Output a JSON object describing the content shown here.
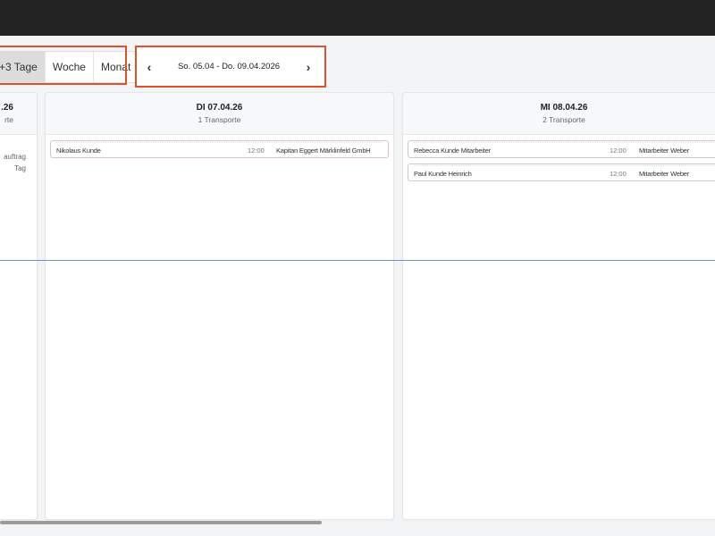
{
  "view_switch": {
    "options": [
      "+3 Tage",
      "Woche",
      "Monat"
    ],
    "active": "+3 Tage"
  },
  "date_nav": {
    "prev_icon": "chevron-left-icon",
    "next_icon": "chevron-right-icon",
    "range": "So. 05.04 - Do. 09.04.2026"
  },
  "days": [
    {
      "title": ".26",
      "subtitle": "rte",
      "note_line1": "auftrag",
      "note_line2": "Tag"
    },
    {
      "title": "DI 07.04.26",
      "subtitle": "1 Transporte",
      "transports": [
        {
          "left": "Nikolaus Kunde",
          "mid": "12:00",
          "right": "Kapitan Eggert Märklinfeld GmbH"
        }
      ]
    },
    {
      "title": "MI 08.04.26",
      "subtitle": "2 Transporte",
      "transports": [
        {
          "left": "Rebecca Kunde Mitarbeiter",
          "mid": "12:00",
          "right": "Mitarbeiter Weber"
        },
        {
          "left": "Paul Kunde Heinrich",
          "mid": "12:00",
          "right": "Mitarbeiter Weber"
        }
      ]
    }
  ],
  "colors": {
    "highlight_outline": "#e0502b",
    "now_line": "#6b8fe6",
    "topbar": "#222222"
  }
}
